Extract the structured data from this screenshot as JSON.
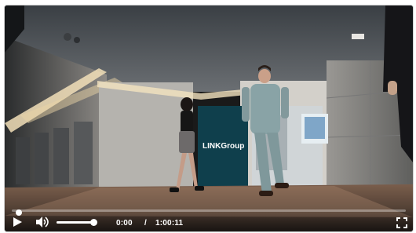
{
  "video": {
    "sign_text": "LINKGroup"
  },
  "controls": {
    "current_time": "0:00",
    "separator": "/",
    "duration": "1:00:11",
    "progress": 0.0,
    "volume": 1.0,
    "play_icon": "play-icon",
    "volume_icon": "volume-icon",
    "fullscreen_icon": "fullscreen-icon"
  }
}
